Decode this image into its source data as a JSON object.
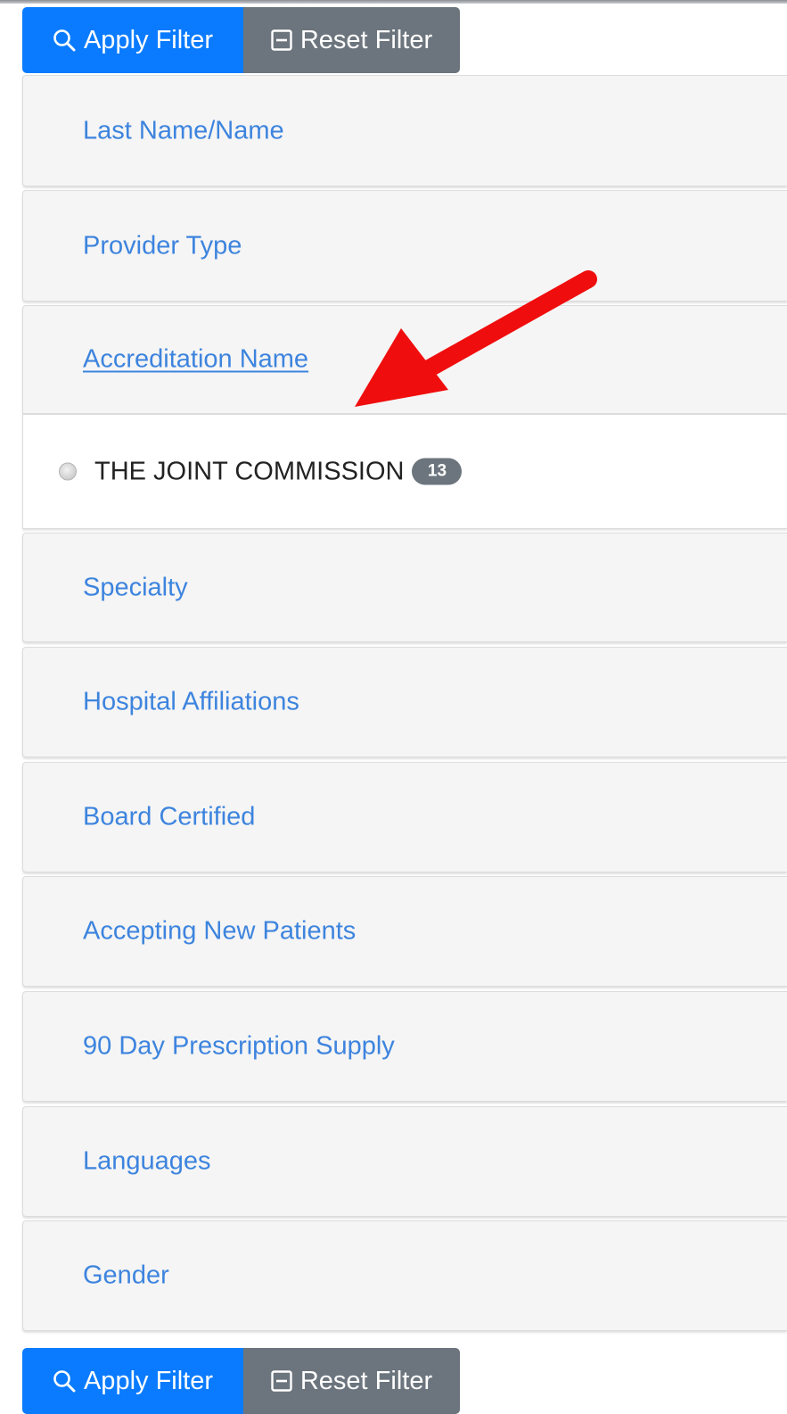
{
  "toolbar_top": {
    "apply_label": "Apply Filter",
    "reset_label": "Reset Filter"
  },
  "toolbar_bottom": {
    "apply_label": "Apply Filter",
    "reset_label": "Reset Filter"
  },
  "filters": [
    {
      "label": "Last Name/Name"
    },
    {
      "label": "Provider Type"
    },
    {
      "label": "Accreditation Name"
    },
    {
      "label": "Specialty"
    },
    {
      "label": "Hospital Affiliations"
    },
    {
      "label": "Board Certified"
    },
    {
      "label": "Accepting New Patients"
    },
    {
      "label": "90 Day Prescription Supply"
    },
    {
      "label": "Languages"
    },
    {
      "label": "Gender"
    }
  ],
  "accreditation_options": [
    {
      "label": "THE JOINT COMMISSION",
      "count": "13"
    }
  ],
  "colors": {
    "apply_button": "#0a7bff",
    "reset_button": "#6c757d",
    "link": "#3d84de",
    "annotation_arrow": "#f00d0d"
  },
  "icons": {
    "apply": "search-icon",
    "reset": "minus-square-icon",
    "option": "radio-icon"
  }
}
